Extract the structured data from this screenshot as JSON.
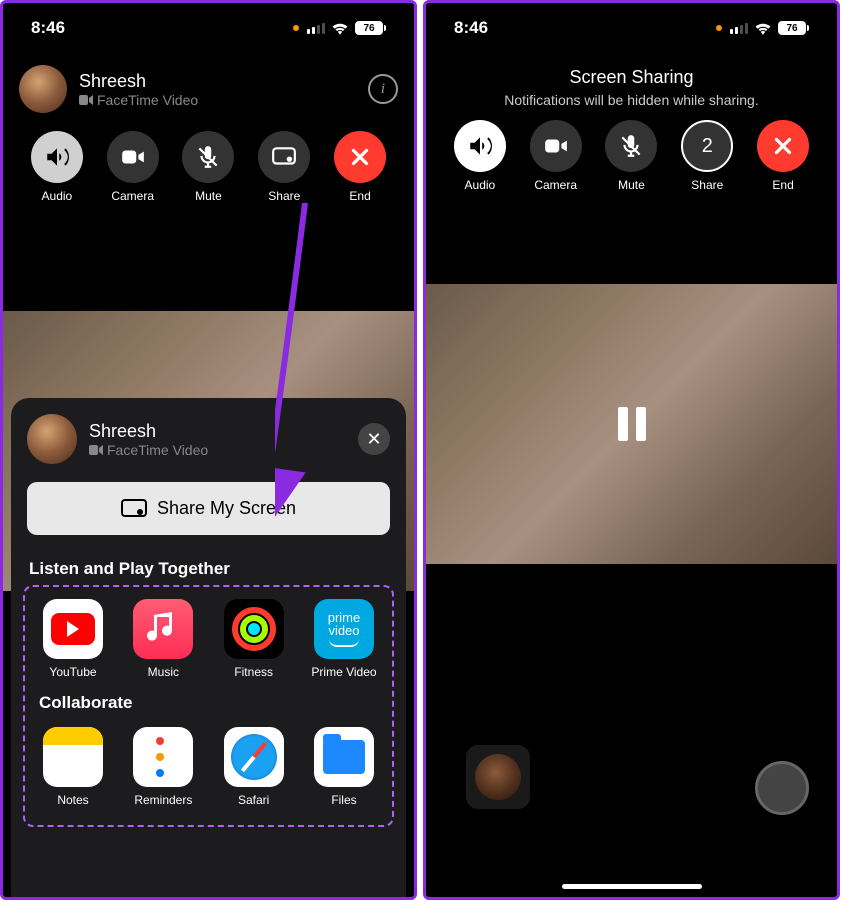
{
  "status": {
    "time": "8:46",
    "battery": "76"
  },
  "left": {
    "header": {
      "name": "Shreesh",
      "subtitle": "FaceTime Video"
    },
    "controls": {
      "audio": "Audio",
      "camera": "Camera",
      "mute": "Mute",
      "share": "Share",
      "end": "End"
    },
    "sheet": {
      "name": "Shreesh",
      "subtitle": "FaceTime Video",
      "shareButton": "Share My Screen",
      "listenTitle": "Listen and Play Together",
      "collaborateTitle": "Collaborate",
      "apps1": {
        "youtube": "YouTube",
        "music": "Music",
        "fitness": "Fitness",
        "prime": "Prime Video"
      },
      "apps2": {
        "notes": "Notes",
        "reminders": "Reminders",
        "safari": "Safari",
        "files": "Files"
      },
      "primeText1": "prime",
      "primeText2": "video"
    }
  },
  "right": {
    "title": "Screen Sharing",
    "subtitle": "Notifications will be hidden while sharing.",
    "controls": {
      "audio": "Audio",
      "camera": "Camera",
      "mute": "Mute",
      "share": "Share",
      "end": "End",
      "shareCount": "2"
    }
  }
}
